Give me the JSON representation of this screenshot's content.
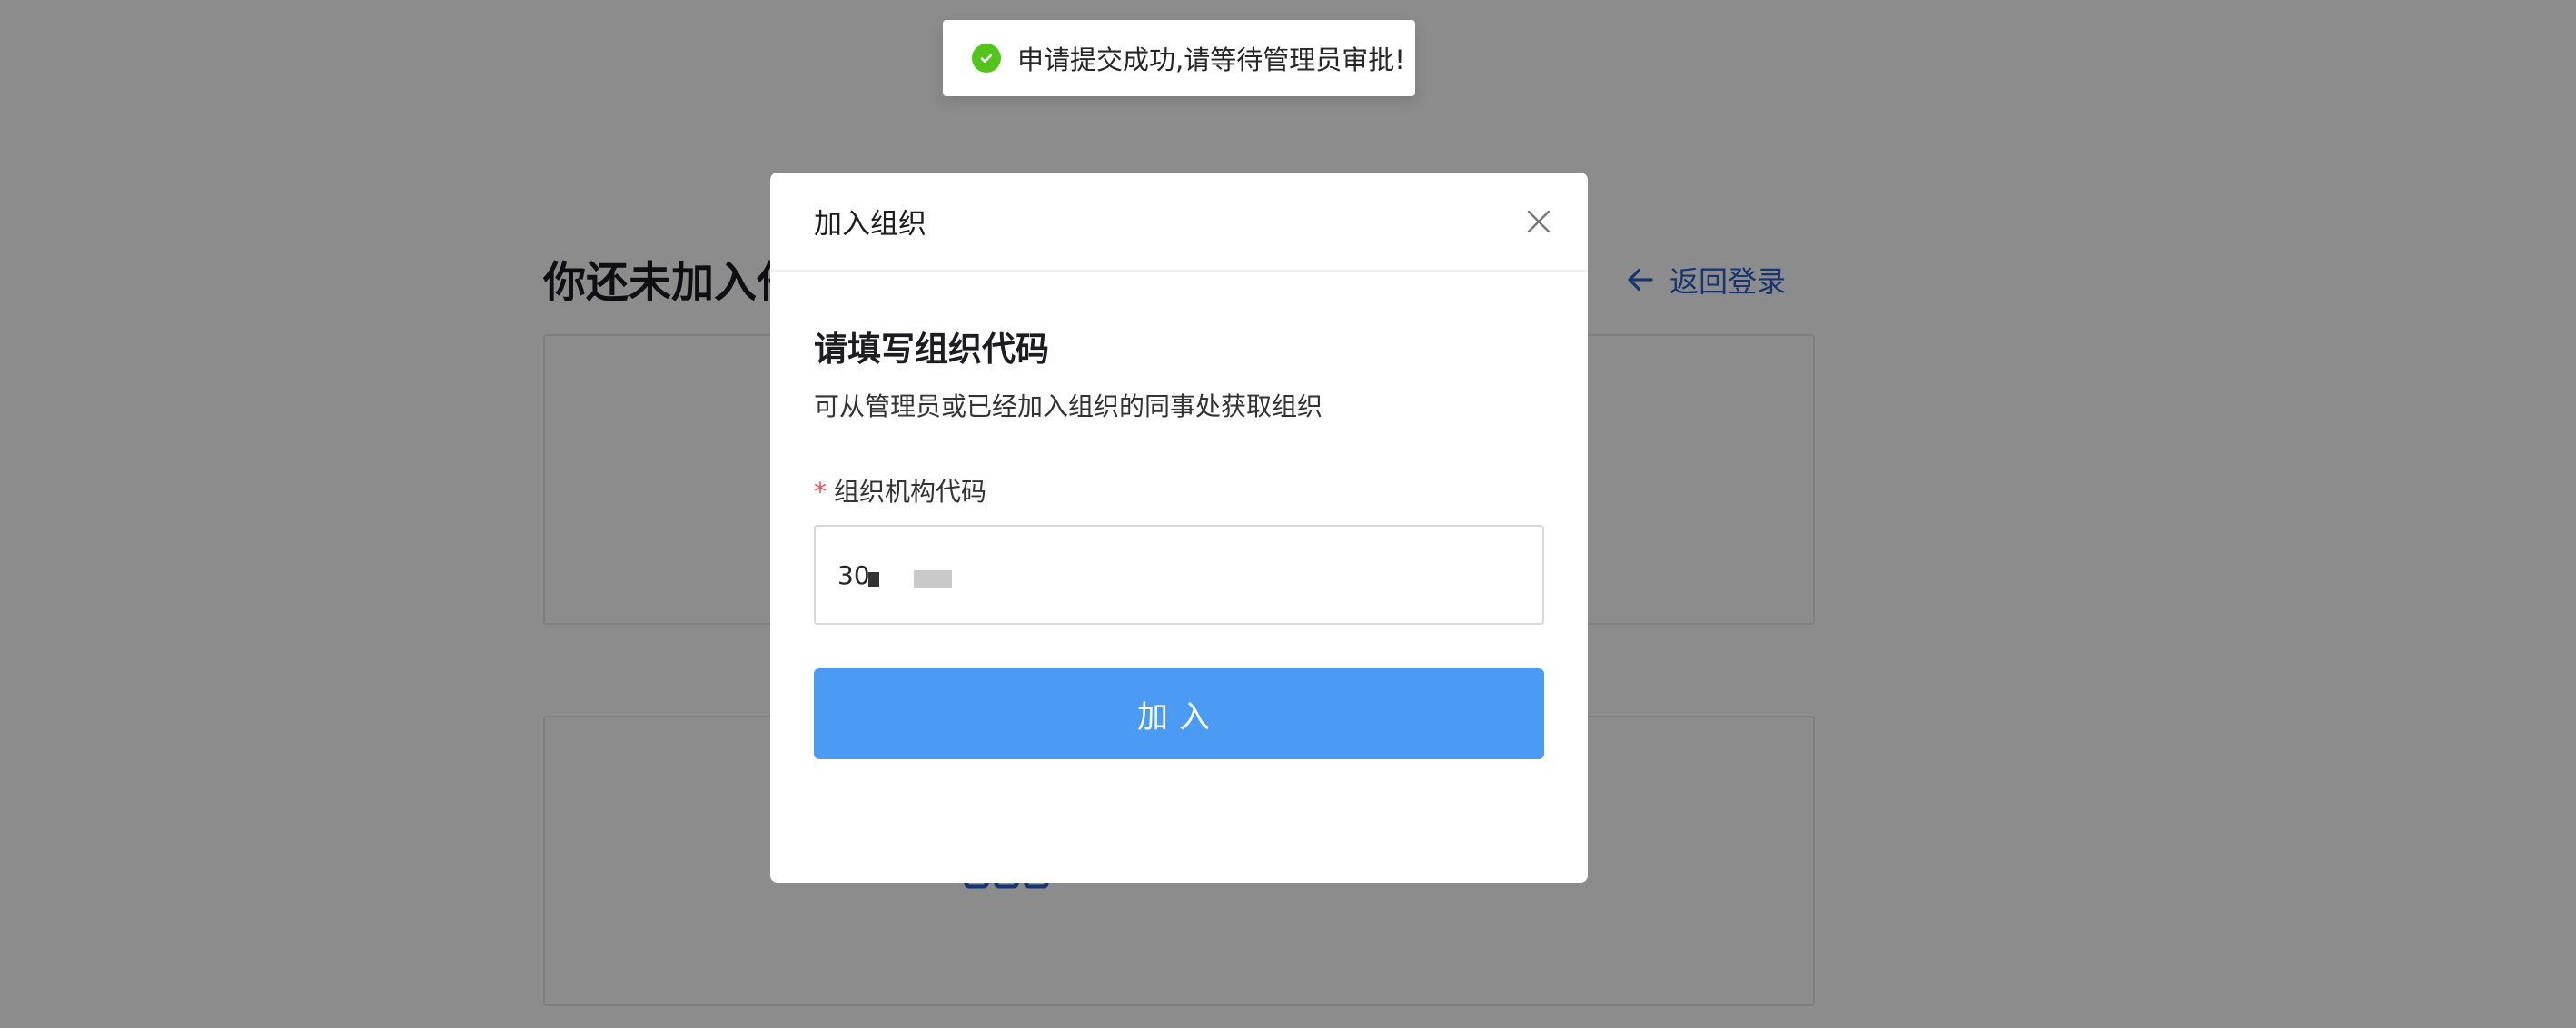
{
  "page": {
    "title": "你还未加入任何组织",
    "back_link": "返回登录"
  },
  "toast": {
    "message": "申请提交成功,请等待管理员审批!",
    "icon": "check-circle-icon",
    "color": "#52c41a"
  },
  "modal": {
    "title": "加入组织",
    "section_title": "请填写组织代码",
    "section_desc": "可从管理员或已经加入组织的同事处获取组织",
    "field_label": "组织机构代码",
    "required_mark": "*",
    "input_value": "30",
    "join_button": "加入",
    "accent": "#4b9af3"
  }
}
